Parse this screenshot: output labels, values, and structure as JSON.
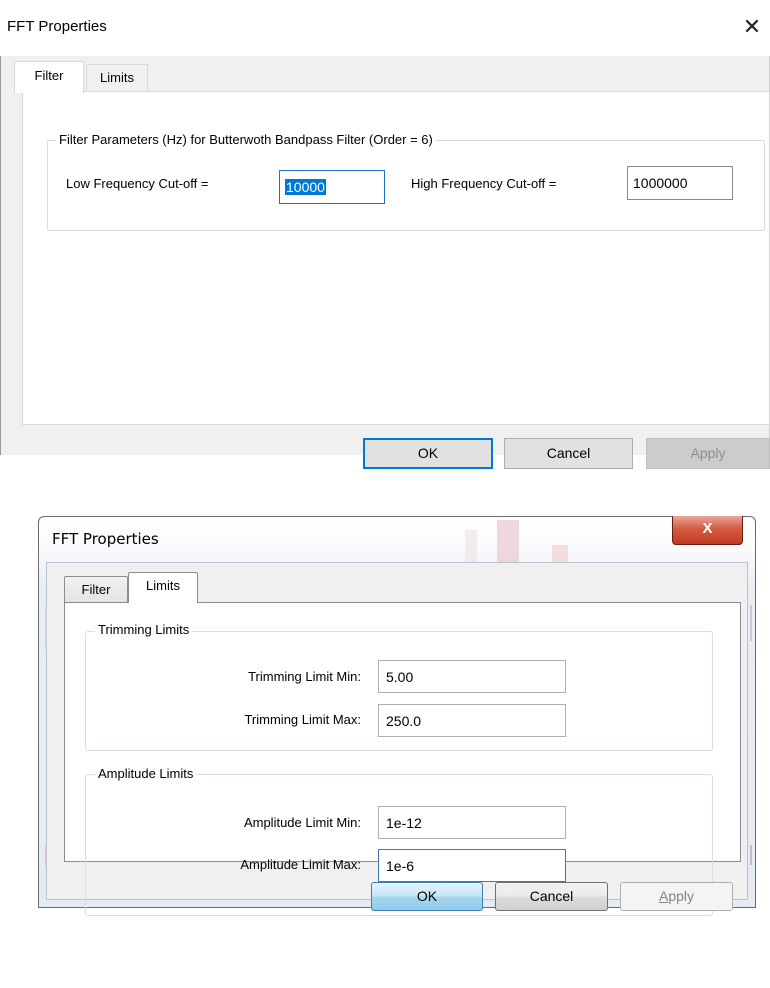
{
  "dialog1": {
    "title": "FFT Properties",
    "close_glyph": "✕",
    "tabs": [
      "Filter",
      "Limits"
    ],
    "active_tab": "Filter",
    "group_label": "Filter Parameters (Hz) for Butterwoth Bandpass Filter (Order = 6)",
    "low_cutoff": {
      "label": "Low Frequency Cut-off =",
      "value": "10000"
    },
    "high_cutoff": {
      "label": "High Frequency Cut-off =",
      "value": "1000000"
    },
    "buttons": {
      "ok": "OK",
      "cancel": "Cancel",
      "apply": "Apply"
    }
  },
  "dialog2": {
    "title": "FFT Properties",
    "close_glyph": "X",
    "tabs": [
      "Filter",
      "Limits"
    ],
    "active_tab": "Limits",
    "trimming": {
      "group_label": "Trimming Limits",
      "min_label": "Trimming Limit Min:",
      "min_value": "5.00",
      "max_label": "Trimming Limit Max:",
      "max_value": "250.0"
    },
    "amplitude": {
      "group_label": "Amplitude Limits",
      "min_label": "Amplitude Limit Min:",
      "min_value": "1e-12",
      "max_label": "Amplitude Limit Max:",
      "max_value": "1e-6"
    },
    "buttons": {
      "ok": "OK",
      "cancel": "Cancel",
      "apply_underlined": "A",
      "apply_rest": "pply"
    }
  },
  "colors": {
    "win10_focus": "#0078d7",
    "win7_close": "#c23b22",
    "win7_default_button": "#8ec9e8"
  }
}
